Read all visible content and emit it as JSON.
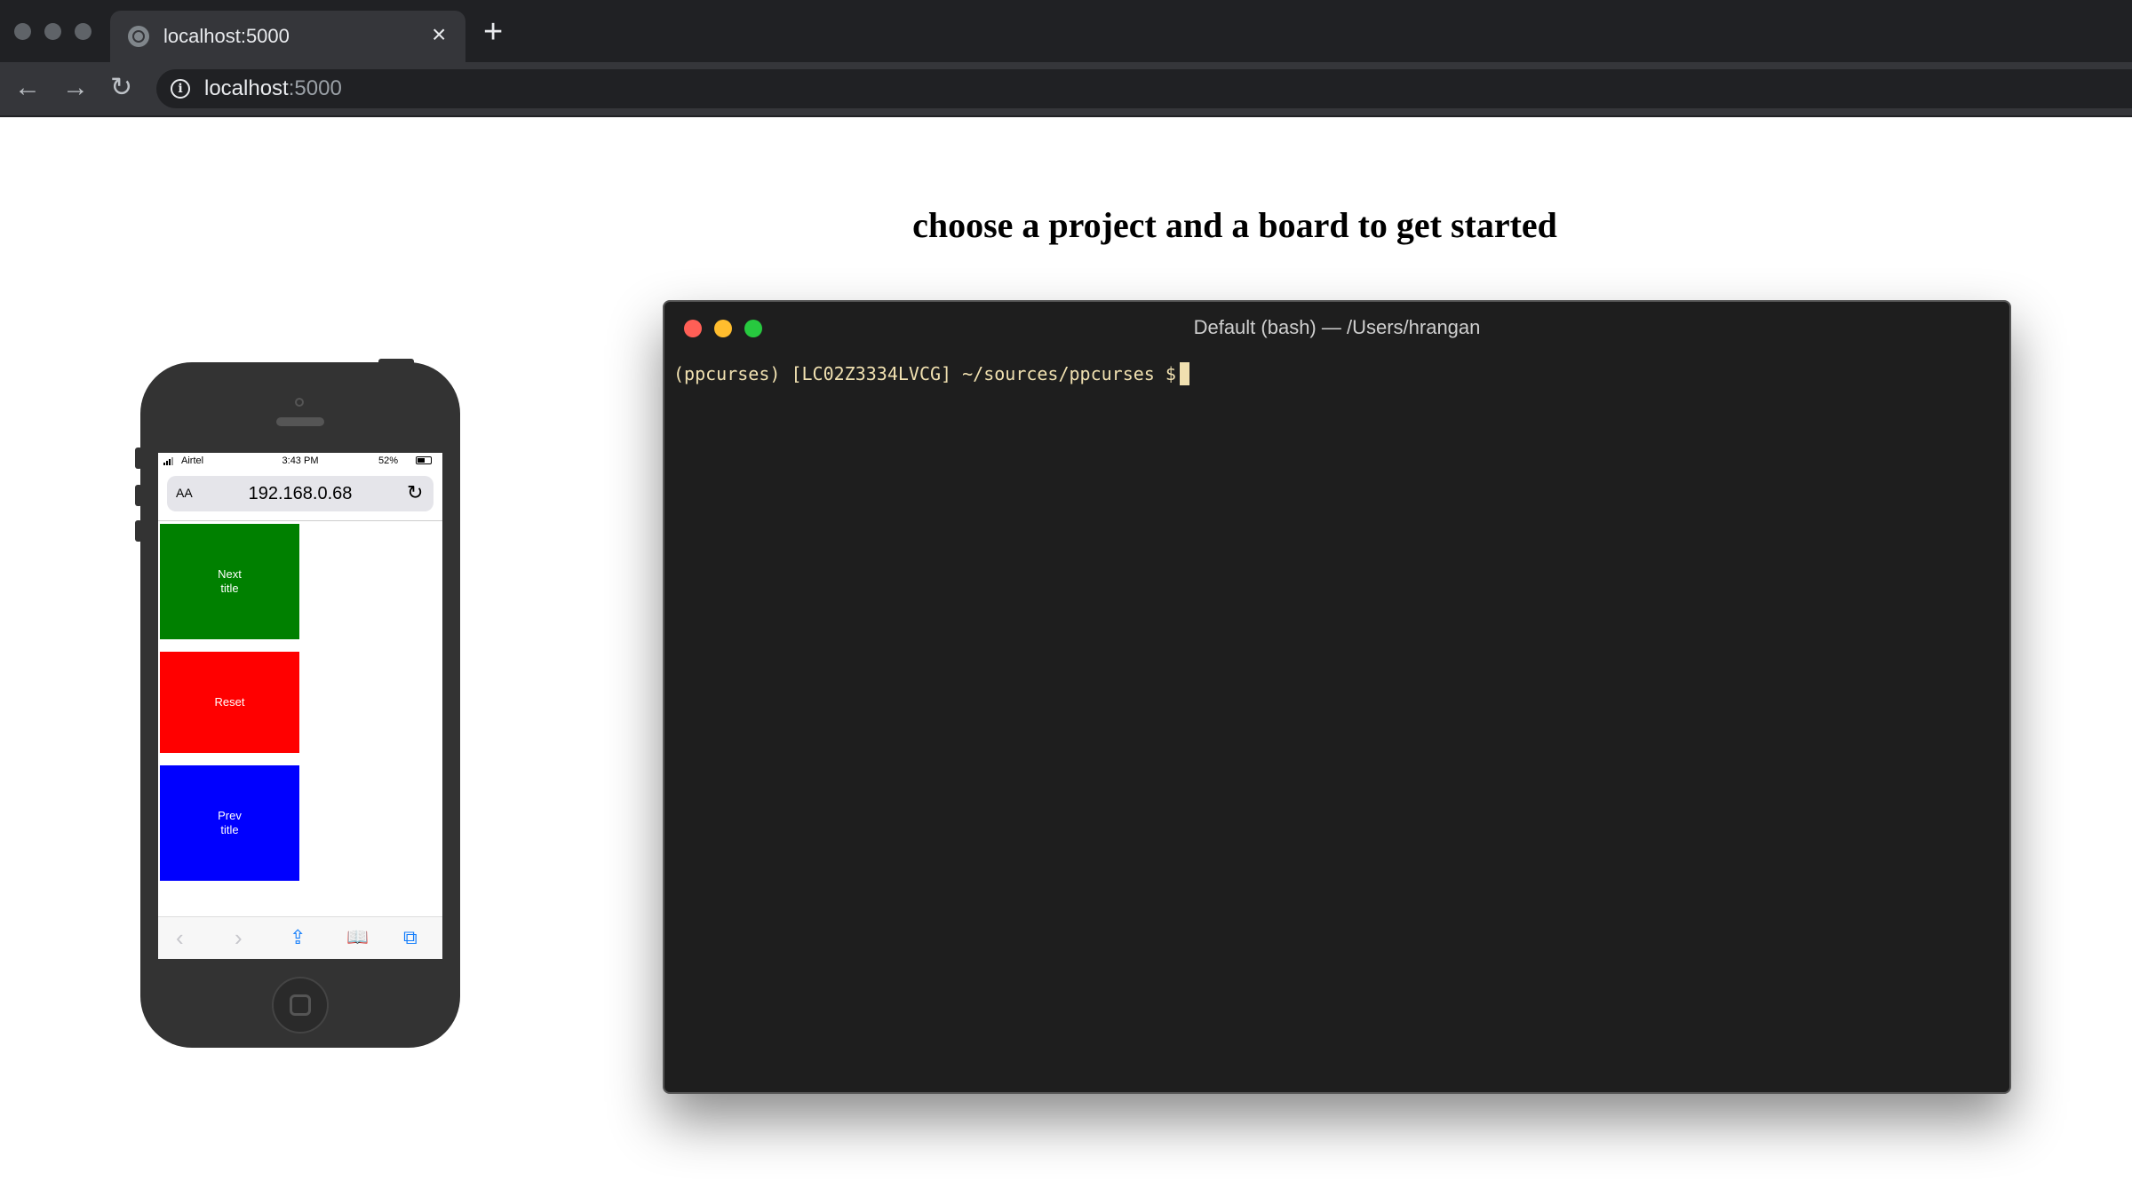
{
  "browser": {
    "tab_title": "localhost:5000",
    "tab_close": "×",
    "new_tab": "+",
    "nav": {
      "back": "←",
      "forward": "→",
      "reload": "↻"
    },
    "url_host": "localhost",
    "url_port": ":5000"
  },
  "page": {
    "heading": "choose a project and a board to get started"
  },
  "phone": {
    "status": {
      "carrier": "Airtel",
      "time": "3:43 PM",
      "battery": "52%"
    },
    "address_bar": {
      "text_size_label": "AA",
      "url": "192.168.0.68",
      "reload": "↻"
    },
    "buttons": [
      {
        "label": "Next\ntitle",
        "color": "#008000"
      },
      {
        "label": "Reset",
        "color": "#ff0000"
      },
      {
        "label": "Prev\ntitle",
        "color": "#0000ff"
      }
    ],
    "toolbar": {
      "back": "‹",
      "forward": "›",
      "share": "⇪",
      "bookmarks": "📖",
      "tabs": "⧉"
    }
  },
  "terminal": {
    "title": "Default (bash) — /Users/hrangan",
    "prompt": "(ppcurses) [LC02Z3334LVCG] ~/sources/ppcurses $"
  },
  "colors": {
    "terminal_bg": "#1e1e1e",
    "close": "#ff5f56",
    "minimize": "#ffbd2e",
    "zoom": "#27c93f",
    "link_blue": "#147efb"
  }
}
